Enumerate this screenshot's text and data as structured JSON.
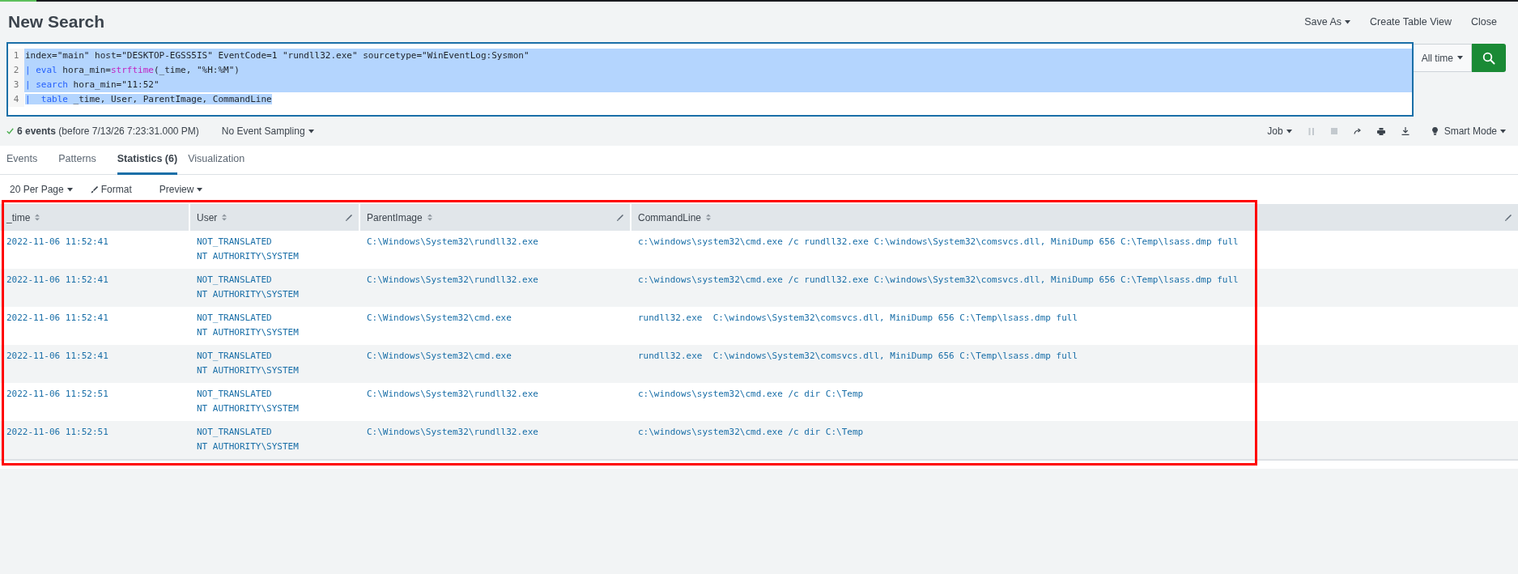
{
  "header": {
    "title": "New Search",
    "actions": [
      {
        "label": "Save As",
        "dropdown": true
      },
      {
        "label": "Create Table View",
        "dropdown": false
      },
      {
        "label": "Close",
        "dropdown": false
      }
    ]
  },
  "search": {
    "selected": true,
    "time_range": "All time",
    "lines": [
      {
        "number": "1",
        "tokens": [
          {
            "kind": "text",
            "text": "index=\"main\" host=\"DESKTOP-EGSS5IS\" EventCode=1 \"rundll32.exe\" sourcetype=\"WinEventLog:Sysmon\""
          }
        ]
      },
      {
        "number": "2",
        "tokens": [
          {
            "kind": "command",
            "text": "| eval"
          },
          {
            "kind": "text",
            "text": " hora_min="
          },
          {
            "kind": "function",
            "text": "strftime"
          },
          {
            "kind": "text",
            "text": "(_time, \"%H:%M\")"
          }
        ]
      },
      {
        "number": "3",
        "tokens": [
          {
            "kind": "command",
            "text": "| search"
          },
          {
            "kind": "text",
            "text": " hora_min=\"11:52\""
          }
        ]
      },
      {
        "number": "4",
        "tokens": [
          {
            "kind": "command",
            "text": "|  table"
          },
          {
            "kind": "text",
            "text": " _time, User, ParentImage, CommandLine"
          }
        ]
      }
    ]
  },
  "status": {
    "count": "6 events",
    "detail": "(before 7/13/26 7:23:31.000 PM)",
    "sampling": "No Event Sampling",
    "job": "Job",
    "mode": "Smart Mode"
  },
  "tabs": [
    {
      "label": "Events",
      "selected": false
    },
    {
      "label": "Patterns",
      "selected": false
    },
    {
      "label": "Statistics (6)",
      "selected": true
    },
    {
      "label": "Visualization",
      "selected": false
    }
  ],
  "toolbar": {
    "per_page": "20 Per Page",
    "format": "Format",
    "preview": "Preview"
  },
  "table": {
    "columns": [
      {
        "label": "_time",
        "editable": false
      },
      {
        "label": "User",
        "editable": true
      },
      {
        "label": "ParentImage",
        "editable": true
      },
      {
        "label": "CommandLine",
        "editable": true
      }
    ],
    "rows": [
      {
        "time": "2022-11-06 11:52:41",
        "user": [
          "NOT_TRANSLATED",
          "NT AUTHORITY\\SYSTEM"
        ],
        "parent_image": "C:\\Windows\\System32\\rundll32.exe",
        "command_line": "c:\\windows\\system32\\cmd.exe /c rundll32.exe C:\\windows\\System32\\comsvcs.dll, MiniDump 656 C:\\Temp\\lsass.dmp full"
      },
      {
        "time": "2022-11-06 11:52:41",
        "user": [
          "NOT_TRANSLATED",
          "NT AUTHORITY\\SYSTEM"
        ],
        "parent_image": "C:\\Windows\\System32\\rundll32.exe",
        "command_line": "c:\\windows\\system32\\cmd.exe /c rundll32.exe C:\\windows\\System32\\comsvcs.dll, MiniDump 656 C:\\Temp\\lsass.dmp full"
      },
      {
        "time": "2022-11-06 11:52:41",
        "user": [
          "NOT_TRANSLATED",
          "NT AUTHORITY\\SYSTEM"
        ],
        "parent_image": "C:\\Windows\\System32\\cmd.exe",
        "command_line": "rundll32.exe  C:\\windows\\System32\\comsvcs.dll, MiniDump 656 C:\\Temp\\lsass.dmp full"
      },
      {
        "time": "2022-11-06 11:52:41",
        "user": [
          "NOT_TRANSLATED",
          "NT AUTHORITY\\SYSTEM"
        ],
        "parent_image": "C:\\Windows\\System32\\cmd.exe",
        "command_line": "rundll32.exe  C:\\windows\\System32\\comsvcs.dll, MiniDump 656 C:\\Temp\\lsass.dmp full"
      },
      {
        "time": "2022-11-06 11:52:51",
        "user": [
          "NOT_TRANSLATED",
          "NT AUTHORITY\\SYSTEM"
        ],
        "parent_image": "C:\\Windows\\System32\\rundll32.exe",
        "command_line": "c:\\windows\\system32\\cmd.exe /c dir C:\\Temp"
      },
      {
        "time": "2022-11-06 11:52:51",
        "user": [
          "NOT_TRANSLATED",
          "NT AUTHORITY\\SYSTEM"
        ],
        "parent_image": "C:\\Windows\\System32\\rundll32.exe",
        "command_line": "c:\\windows\\system32\\cmd.exe /c dir C:\\Temp"
      }
    ]
  }
}
